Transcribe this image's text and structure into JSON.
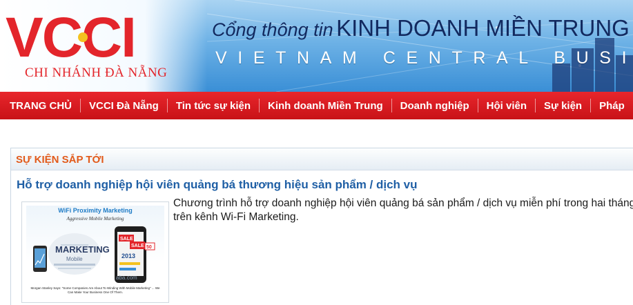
{
  "header": {
    "logo_text": "VCCI",
    "branch": "CHI NHÁNH ĐÀ NẴNG",
    "portal_prefix": "Cổng thông tin",
    "portal_main": "KINH DOANH MIỀN TRUNG",
    "portal_sub": "VIETNAM CENTRAL BUSINESS",
    "colors": {
      "brand_red": "#e3252b",
      "title_navy": "#12295f",
      "sky": "#6eb2e6"
    }
  },
  "nav": {
    "items": [
      {
        "label": "TRANG CHỦ"
      },
      {
        "label": "VCCI Đà Nẵng"
      },
      {
        "label": "Tin tức sự kiện"
      },
      {
        "label": "Kinh doanh Miền Trung"
      },
      {
        "label": "Doanh nghiệp"
      },
      {
        "label": "Hội viên"
      },
      {
        "label": "Sự kiện"
      },
      {
        "label": "Pháp"
      }
    ],
    "background": "#d81c22"
  },
  "section": {
    "heading": "SỰ KIỆN SẮP TỚI",
    "heading_color": "#e25a1a"
  },
  "article": {
    "title": "Hỗ trợ doanh nghiệp hội viên quảng bá thương hiệu sản phẩm / dịch vụ",
    "summary": "Chương trình hỗ trợ doanh nghiệp hội viên quảng bá sản phẩm / dịch vụ miễn phí trong hai tháng trên kênh Wi-Fi Marketing.",
    "title_color": "#1f5fa5",
    "thumbnail": {
      "title": "WiFi Proximity Marketing",
      "subtitle": "Aggressive Mobile Marketing",
      "words": [
        "MARKETING",
        "Mobile",
        "SALE",
        "SALE",
        "50",
        "2013"
      ],
      "quote": "Morgan Stanley Says: \"Some Companies Are About To Winding With Mobile Marketing\" ... We Can Make Your Business One Of Them.",
      "watermark": "aba.com"
    }
  }
}
